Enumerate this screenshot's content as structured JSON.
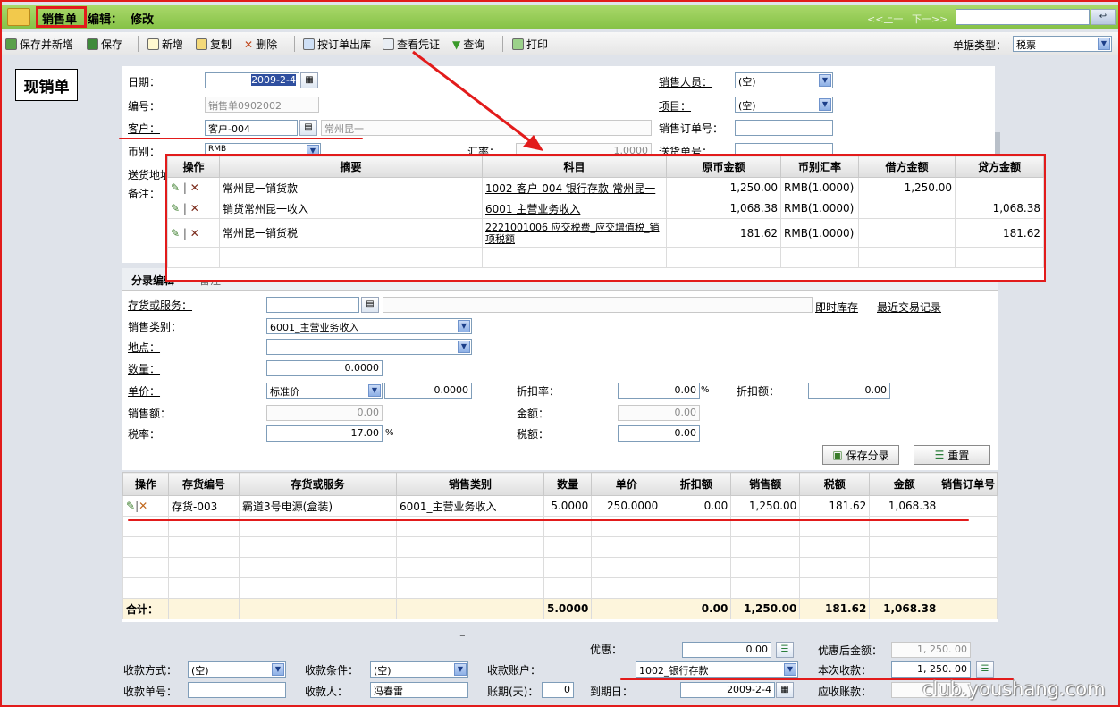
{
  "title": {
    "doc": "销售单",
    "mode": "编辑：",
    "action": "修改",
    "prev": "<<上一",
    "next": "下一>>"
  },
  "toolbar": {
    "save_new": "保存并新增",
    "save": "保存",
    "new": "新增",
    "copy": "复制",
    "delete": "删除",
    "out_by_order": "按订单出库",
    "view_voucher": "查看凭证",
    "query": "查询",
    "print": "打印",
    "doc_type_label": "单据类型：",
    "doc_type_value": "税票"
  },
  "form": {
    "badge": "现销单",
    "date_label": "日期：",
    "date_value": "2009-2-4",
    "no_label": "编号：",
    "no_value": "销售单0902002",
    "customer_label": "客户：",
    "customer_value": "客户-004",
    "customer_name": "常州昆一",
    "currency_label": "币别：",
    "currency_value": "RMB",
    "rate_label": "汇率：",
    "rate_value": "1.0000",
    "address_label": "送货地址：",
    "remark_label": "备注：",
    "salesman_label": "销售人员：",
    "salesman_value": "(空)",
    "project_label": "项目：",
    "project_value": "(空)",
    "order_no_label": "销售订单号：",
    "delivery_no_label": "送货单号："
  },
  "voucher": {
    "headers": [
      "操作",
      "摘要",
      "科目",
      "原币金额",
      "币别汇率",
      "借方金额",
      "贷方金额"
    ],
    "rows": [
      {
        "summary": "常州昆一销货款",
        "subject": "1002-客户-004 银行存款-常州昆一",
        "orig": "1,250.00",
        "rate": "RMB(1.0000)",
        "debit": "1,250.00",
        "credit": ""
      },
      {
        "summary": "销货常州昆一收入",
        "subject": "6001 主营业务收入",
        "orig": "1,068.38",
        "rate": "RMB(1.0000)",
        "debit": "",
        "credit": "1,068.38"
      },
      {
        "summary": "常州昆一销货税",
        "subject": "2221001006 应交税费_应交增值税_销项税额",
        "orig": "181.62",
        "rate": "RMB(1.0000)",
        "debit": "",
        "credit": "181.62"
      }
    ]
  },
  "entry": {
    "tab1": "分录编辑",
    "tab2": "备注",
    "inventory_label": "存货或服务：",
    "stock_link": "即时库存",
    "recent_link": "最近交易记录",
    "sales_type_label": "销售类别：",
    "sales_type_value": "6001_主营业务收入",
    "location_label": "地点：",
    "qty_label": "数量：",
    "qty_value": "0.0000",
    "price_label": "单价：",
    "price_type": "标准价",
    "price_value": "0.0000",
    "disc_rate_label": "折扣率：",
    "disc_rate_value": "0.00",
    "pct": "%",
    "disc_amt_label": "折扣额：",
    "disc_amt_value": "0.00",
    "sales_amt_label": "销售额：",
    "sales_amt_value": "0.00",
    "amount_label": "金额：",
    "amount_value": "0.00",
    "tax_rate_label": "税率：",
    "tax_rate_value": "17.00",
    "tax_label": "税额：",
    "tax_value": "0.00",
    "save_entry": "保存分录",
    "reset": "重置"
  },
  "items": {
    "headers": [
      "操作",
      "存货编号",
      "存货或服务",
      "销售类别",
      "数量",
      "单价",
      "折扣额",
      "销售额",
      "税额",
      "金额",
      "销售订单号"
    ],
    "rows": [
      {
        "code": "存货-003",
        "name": "霸道3号电源(盒装)",
        "type": "6001_主营业务收入",
        "qty": "5.0000",
        "price": "250.0000",
        "disc": "0.00",
        "sales": "1,250.00",
        "tax": "181.62",
        "amount": "1,068.38",
        "order": ""
      }
    ],
    "total_label": "合计：",
    "total": {
      "qty": "5.0000",
      "disc": "0.00",
      "sales": "1,250.00",
      "tax": "181.62",
      "amount": "1,068.38"
    }
  },
  "footer": {
    "pay_method_label": "收款方式：",
    "pay_method": "(空)",
    "pay_cond_label": "收款条件：",
    "pay_cond": "(空)",
    "account_label": "收款账户：",
    "account": "1002_银行存款",
    "discount_label": "优惠：",
    "discount": "0.00",
    "after_disc_label": "优惠后金额：",
    "after_disc": "1, 250. 00",
    "this_pay_label": "本次收款：",
    "this_pay": "1, 250. 00",
    "receipt_no_label": "收款单号：",
    "payee_label": "收款人：",
    "payee": "冯春雷",
    "term_label": "账期(天)：",
    "term": "0",
    "due_label": "到期日：",
    "due": "2009-2-4",
    "receivable_label": "应收账款：",
    "watermark": "club.youshang.com"
  }
}
